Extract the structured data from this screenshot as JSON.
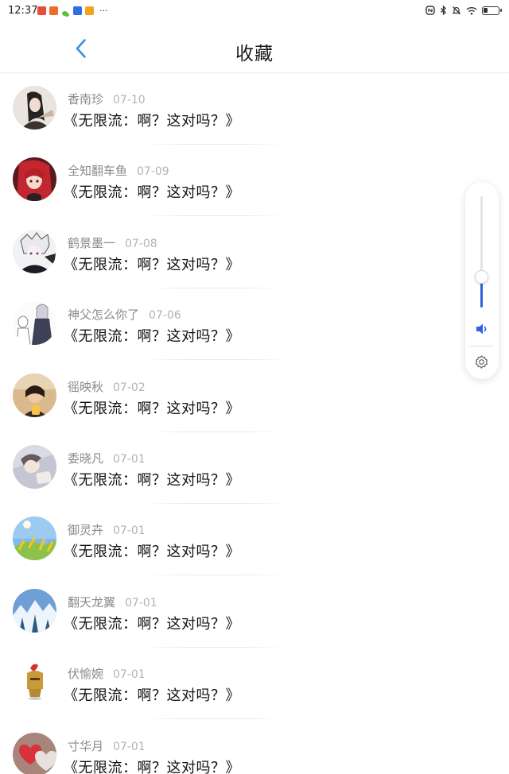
{
  "status_bar": {
    "time": "12:37",
    "more": "···",
    "app_icons": [
      {
        "name": "red-app-icon",
        "color": "#e94b3c"
      },
      {
        "name": "orange-app-icon",
        "color": "#ef6c2d"
      },
      {
        "name": "wechat-icon",
        "color": "#5fbf3c"
      },
      {
        "name": "blue-app-icon",
        "color": "#2f6fe0"
      },
      {
        "name": "yellow-app-icon",
        "color": "#f2a51a"
      }
    ],
    "battery_level": 0.3
  },
  "header": {
    "back_icon": "chevron-left-icon",
    "title": "收藏"
  },
  "favorites": [
    {
      "name": "香南珍",
      "date": "07-10",
      "content": "《无限流：啊？这对吗？》"
    },
    {
      "name": "全知翻车鱼",
      "date": "07-09",
      "content": "《无限流：啊？这对吗？》"
    },
    {
      "name": "鹤景墨一",
      "date": "07-08",
      "content": "《无限流：啊？这对吗？》"
    },
    {
      "name": "神父怎么你了",
      "date": "07-06",
      "content": "《无限流：啊？这对吗？》"
    },
    {
      "name": "徭映秋",
      "date": "07-02",
      "content": "《无限流：啊？这对吗？》"
    },
    {
      "name": "委晓凡",
      "date": "07-01",
      "content": "《无限流：啊？这对吗？》"
    },
    {
      "name": "御灵卉",
      "date": "07-01",
      "content": "《无限流：啊？这对吗？》"
    },
    {
      "name": "翻天龙翼",
      "date": "07-01",
      "content": "《无限流：啊？这对吗？》"
    },
    {
      "name": "伏愉婉",
      "date": "07-01",
      "content": "《无限流：啊？这对吗？》"
    },
    {
      "name": "寸华月",
      "date": "07-01",
      "content": "《无限流：啊？这对吗？》"
    }
  ],
  "volume_panel": {
    "level": 0.27,
    "speaker_icon": "speaker-icon",
    "settings_icon": "gear-icon",
    "accent": "#2f62e0"
  }
}
